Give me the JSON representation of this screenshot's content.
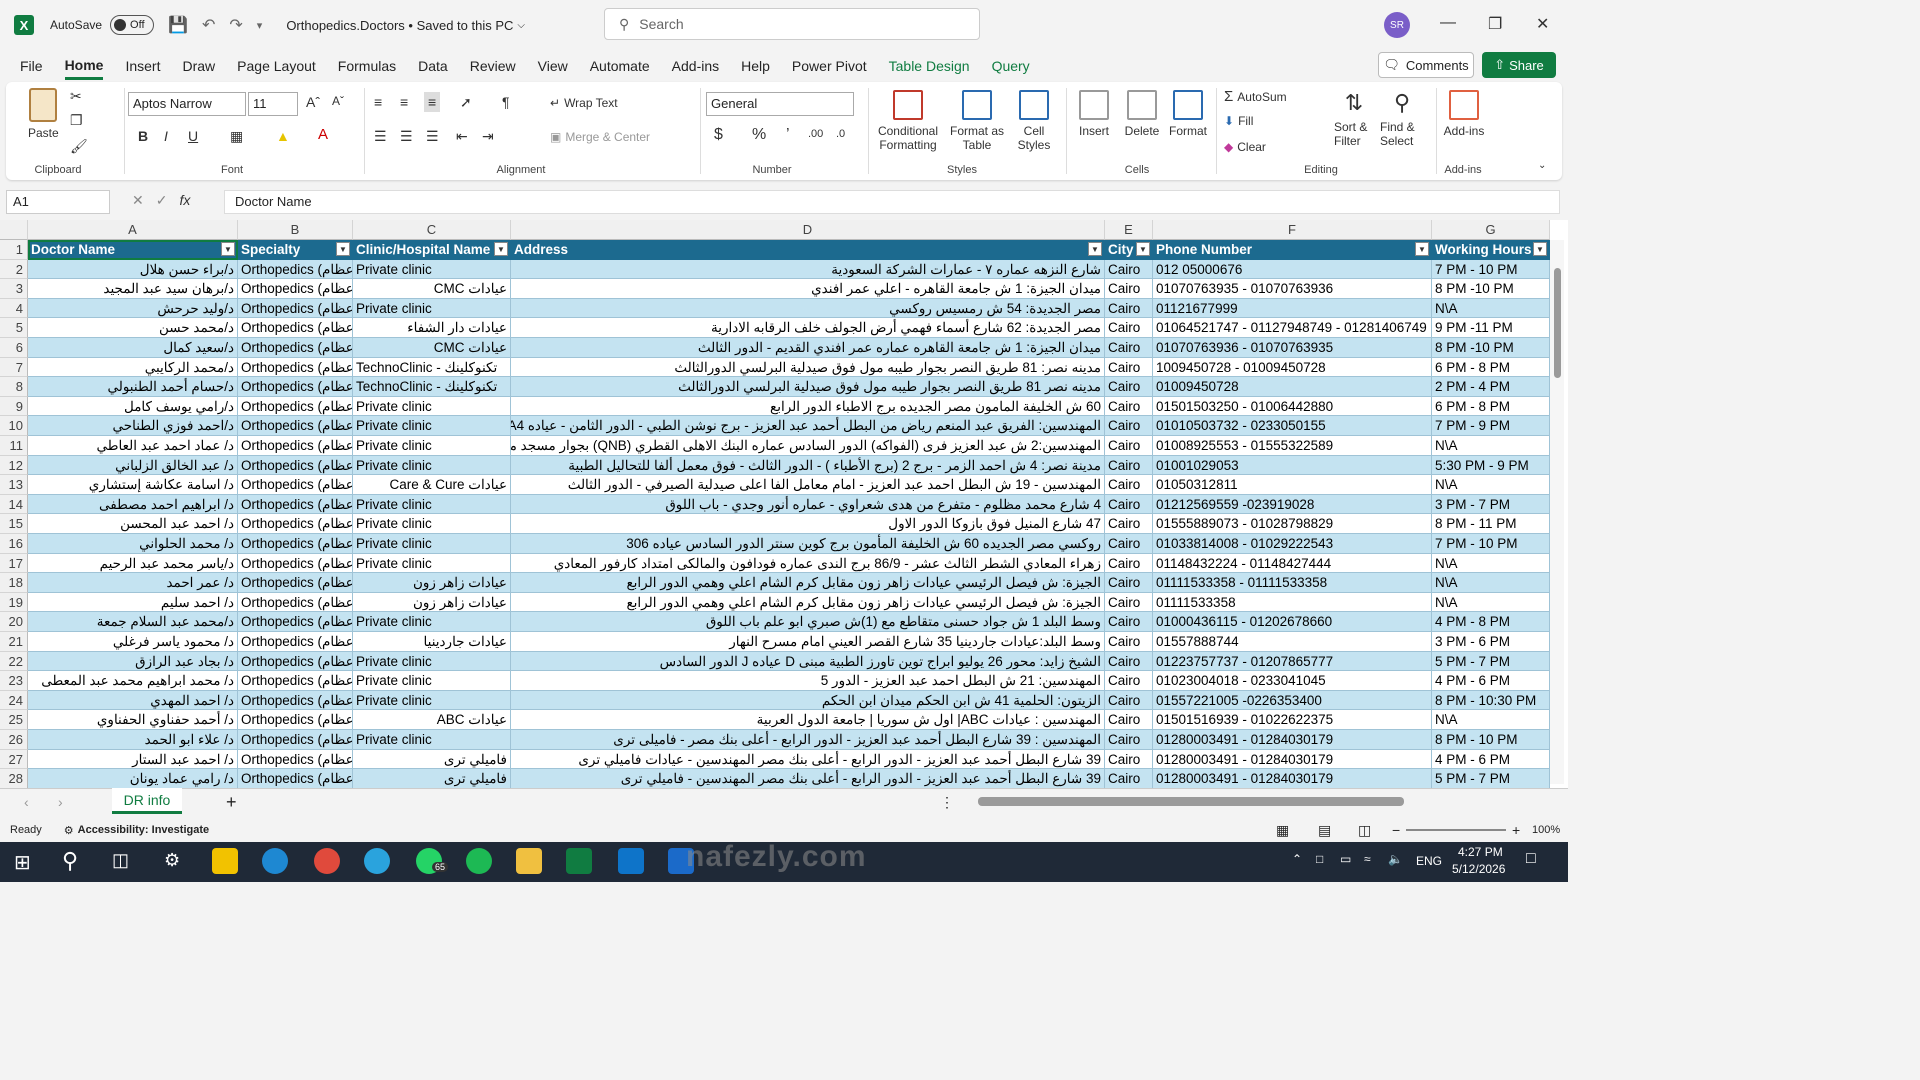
{
  "titlebar": {
    "autosave_label": "AutoSave",
    "autosave_state": "Off",
    "doc_title": "Orthopedics.Doctors • Saved to this PC",
    "search_placeholder": "Search",
    "user_initials": "SR"
  },
  "menu": {
    "items": [
      "File",
      "Home",
      "Insert",
      "Draw",
      "Page Layout",
      "Formulas",
      "Data",
      "Review",
      "View",
      "Automate",
      "Add-ins",
      "Help",
      "Power Pivot",
      "Table Design",
      "Query"
    ],
    "active": "Home",
    "comments_label": "Comments",
    "share_label": "Share"
  },
  "ribbon": {
    "paste": "Paste",
    "font_name": "Aptos Narrow",
    "font_size": "11",
    "wrap_text": "Wrap Text",
    "merge_center": "Merge & Center",
    "number_format": "General",
    "conditional_formatting": "Conditional Formatting",
    "format_as_table": "Format as Table",
    "cell_styles": "Cell Styles",
    "insert": "Insert",
    "delete": "Delete",
    "format": "Format",
    "autosum": "AutoSum",
    "fill": "Fill",
    "clear": "Clear",
    "sort_filter": "Sort & Filter",
    "find_select": "Find & Select",
    "add_ins": "Add-ins",
    "groups": [
      "Clipboard",
      "Font",
      "Alignment",
      "Number",
      "Styles",
      "Cells",
      "Editing",
      "Add-ins"
    ]
  },
  "formula_bar": {
    "name_box": "A1",
    "formula": "Doctor Name"
  },
  "sheet": {
    "column_letters": [
      "A",
      "B",
      "C",
      "D",
      "E",
      "F",
      "G"
    ],
    "headers": [
      "Doctor Name",
      "Specialty",
      "Clinic/Hospital Name",
      "Address",
      "City",
      "Phone Number",
      "Working Hours"
    ],
    "rows": [
      [
        "د/براء حسن هلال",
        "Orthopedics (عظام)",
        "Private clinic",
        "شارع النزهه عماره ٧ - عمارات الشركة السعودية",
        "Cairo",
        "012 05000676",
        "7 PM - 10 PM"
      ],
      [
        "د/برهان سيد عبد المجيد",
        "Orthopedics (عظام)",
        "عيادات CMC",
        "ميدان الجيزة: 1 ش جامعة القاهره - اعلي عمر افندي",
        "Cairo",
        "01070763935 - 01070763936",
        "8 PM -10 PM"
      ],
      [
        "د/وليد حرحش",
        "Orthopedics (عظام)",
        "Private clinic",
        "مصر الجديدة: 54 ش رمسيس روكسي",
        "Cairo",
        "01121677999",
        "N\\A"
      ],
      [
        "د/محمد حسن",
        "Orthopedics (عظام)",
        "عيادات دار الشفاء",
        "مصر الجديدة: 62 شارع أسماء فهمي أرض الجولف خلف الرقابه الادارية",
        "Cairo",
        "01064521747 - 01127948749 - 01281406749",
        "9 PM -11 PM"
      ],
      [
        "د/سعيد كمال",
        "Orthopedics (عظام)",
        "عيادات CMC",
        "ميدان الجيزة: 1 ش جامعة القاهره عماره عمر افندي القديم - الدور الثالث",
        "Cairo",
        "01070763936 - 01070763935",
        "8 PM -10 PM"
      ],
      [
        "د/محمد الركايبي",
        "Orthopedics (عظام)",
        "TechnoClinic - تكنوكلينك",
        "مدينه نصر: 81 طريق النصر بجوار طيبه مول فوق صيدلية البرلسي الدورالثالث",
        "Cairo",
        "1009450728 - 01009450728",
        "6 PM - 8 PM"
      ],
      [
        "د/حسام أحمد الطنبولي",
        "Orthopedics (عظام)",
        "TechnoClinic - تكنوكلينك",
        "مدينه نصر 81 طريق النصر بجوار طيبه مول فوق صيدلية البرلسي الدورالثالث",
        "Cairo",
        "01009450728",
        "2 PM - 4 PM"
      ],
      [
        "د/رامي يوسف كامل",
        "Orthopedics (عظام)",
        "Private clinic",
        "60 ش الخليفة المامون مصر الجديده برج الاطباء الدور الرابع",
        "Cairo",
        "01501503250 - 01006442880",
        "6 PM - 8 PM"
      ],
      [
        "د/احمد فوزي الطناحي",
        "Orthopedics (عظام)",
        "Private clinic",
        "المهندسين: الفريق عبد المنعم رياض من البطل أحمد عبد العزيز - برج نوشن الطبي - الدور الثامن - عياده A4",
        "Cairo",
        "01010503732 - 0233050155",
        "7 PM - 9 PM"
      ],
      [
        "د/ عماد احمد عبد العاطي",
        "Orthopedics (عظام)",
        "Private clinic",
        "المهندسين:2 ش عبد العزيز فرى (الفواكه) الدور السادس عماره البنك الاهلى القطري (QNB) بجوار مسجد مصطفى محمود",
        "Cairo",
        "01008925553 - 01555322589",
        "N\\A"
      ],
      [
        "د/ عبد الخالق الزلباني",
        "Orthopedics (عظام)",
        "Private clinic",
        "مدينة نصر: 4 ش احمد الزمر - برج 2 (برج الأطباء ) - الدور الثالث - فوق معمل ألفا للتحاليل الطبية",
        "Cairo",
        "01001029053",
        "5:30 PM - 9 PM"
      ],
      [
        "د/ اسامة عكاشة إستشاري",
        "Orthopedics (عظام)",
        "عيادات Care & Cure",
        "المهندسين - 19 ش البطل احمد عبد العزيز - امام معامل الفا اعلى صيدلية الصيرفي - الدور الثالث",
        "Cairo",
        "01050312811",
        "N\\A"
      ],
      [
        "د/ ابراهيم احمد مصطفى",
        "Orthopedics (عظام)",
        "Private clinic",
        "4 شارع محمد مظلوم - متفرع من هدى شعراوي - عماره أنور وجدي - باب اللوق",
        "Cairo",
        "01212569559 -023919028",
        "3 PM - 7 PM"
      ],
      [
        "د/ احمد عبد المحسن",
        "Orthopedics (عظام)",
        "Private clinic",
        "47 شارع المنيل فوق بازوكا الدور الاول",
        "Cairo",
        "01555889073 - 01028798829",
        "8 PM - 11 PM"
      ],
      [
        "د/ محمد الحلواني",
        "Orthopedics (عظام)",
        "Private clinic",
        "روكسي مصر الجديده 60 ش الخليفة المأمون برج كوين سنتر الدور السادس عياده 306",
        "Cairo",
        "01033814008 - 01029222543",
        "7 PM - 10 PM"
      ],
      [
        "د/ياسر محمد عبد الرحيم",
        "Orthopedics (عظام)",
        "Private clinic",
        "زهراء المعادي الشطر الثالث عشر - 86/9 برج الندى عماره فودافون والمالكى امتداد كارفور المعادي",
        "Cairo",
        "01148432224 - 01148427444",
        "N\\A"
      ],
      [
        "د/ عمر احمد",
        "Orthopedics (عظام)",
        "عيادات زاهر زون",
        "الجيزة: ش فيصل الرئيسي عيادات زاهر زون مقابل كرم الشام اعلي وهمي الدور الرابع",
        "Cairo",
        "01111533358 - 01111533358",
        "N\\A"
      ],
      [
        "د/ احمد سليم",
        "Orthopedics (عظام)",
        "عيادات زاهر زون",
        "الجيزة: ش فيصل الرئيسي عيادات زاهر زون مقابل كرم الشام اعلي وهمي الدور الرابع",
        "Cairo",
        "01111533358",
        "N\\A"
      ],
      [
        "د/محمد عبد السلام جمعة",
        "Orthopedics (عظام)",
        "Private clinic",
        "وسط البلد 1 ش جواد حسنى متقاطع مع (1)ش صبري ابو علم باب اللوق",
        "Cairo",
        "01000436115 - 01202678660",
        "4 PM - 8 PM"
      ],
      [
        "د/ محمود ياسر فرغلي",
        "Orthopedics (عظام)",
        "عيادات جاردينيا",
        "وسط البلد:عيادات جاردينيا 35 شارع القصر العيني امام مسرح النهار",
        "Cairo",
        "01557888744",
        "3 PM - 6 PM"
      ],
      [
        "د/ بجاد عبد الرازق",
        "Orthopedics (عظام)",
        "Private clinic",
        "الشيخ زايد: محور 26 يوليو ابراج توين تاورز الطبية مبنى D عياده J الدور السادس",
        "Cairo",
        "01223757737 - 01207865777",
        "5 PM - 7 PM"
      ],
      [
        "د/ محمد ابراهيم محمد عبد المعطى",
        "Orthopedics (عظام)",
        "Private clinic",
        "المهندسين: 21 ش البطل احمد عبد العزيز - الدور 5",
        "Cairo",
        "01023004018 - 0233041045",
        "4 PM - 6 PM"
      ],
      [
        "د/ احمد المهدي",
        "Orthopedics (عظام)",
        "Private clinic",
        "الزيتون: الحلمية 41 ش ابن الحكم ميدان ابن الحكم",
        "Cairo",
        "01557221005 -0226353400",
        "8 PM - 10:30 PM"
      ],
      [
        "د/ أحمد حفناوي الحفناوي",
        "Orthopedics (عظام)",
        "عيادات ABC",
        "المهندسين : عيادات ABC| اول ش سوريا | جامعة الدول العربية",
        "Cairo",
        "01501516939 - 01022622375",
        "N\\A"
      ],
      [
        "د/ علاء ابو الحمد",
        "Orthopedics (عظام)",
        "Private clinic",
        "المهندسين : 39 شارع البطل أحمد عبد العزيز - الدور الرابع - أعلى بنك مصر - فاميلى ترى",
        "Cairo",
        "01280003491 - 01284030179",
        "8 PM - 10 PM"
      ],
      [
        "د/ احمد عبد الستار",
        "Orthopedics (عظام)",
        "فاميلي ترى",
        "39 شارع البطل أحمد عبد العزيز - الدور الرابع - أعلى بنك مصر المهندسين - عيادات فاميلي ترى",
        "Cairo",
        "01280003491 - 01284030179",
        "4 PM - 6 PM"
      ],
      [
        "د/ رامي عماد يونان",
        "Orthopedics (عظام)",
        "فاميلي ترى",
        "39 شارع البطل أحمد عبد العزيز - الدور الرابع - أعلى بنك مصر المهندسين - فاميلي ترى",
        "Cairo",
        "01280003491 - 01284030179",
        "5 PM - 7 PM"
      ]
    ]
  },
  "tabs": {
    "sheet_name": "DR info",
    "add_label": "+"
  },
  "status": {
    "ready": "Ready",
    "accessibility": "Accessibility: Investigate",
    "zoom": "100%"
  },
  "taskbar": {
    "time": "4:27 PM",
    "date": "5/12/2026",
    "lang": "ENG",
    "whatsapp_badge": "65"
  },
  "watermark": "nafezly.com",
  "colors": {
    "excel_green": "#107c41",
    "header_blue": "#1c6a8f",
    "band_blue": "#c4e3f1"
  }
}
